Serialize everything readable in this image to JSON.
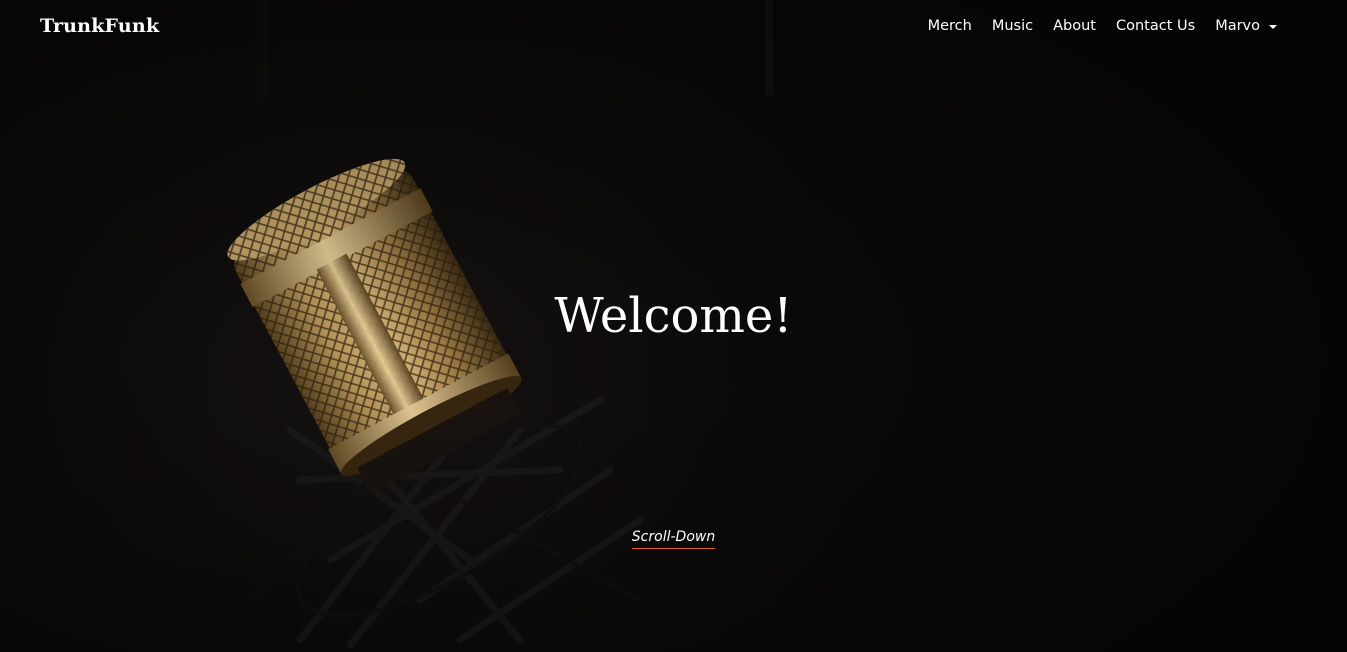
{
  "navbar": {
    "brand": "TrunkFunk",
    "links": [
      {
        "label": "Merch"
      },
      {
        "label": "Music"
      },
      {
        "label": "About"
      },
      {
        "label": "Contact Us"
      }
    ],
    "dropdown": {
      "label": "Marvo",
      "icon": "caret-down-icon"
    }
  },
  "hero": {
    "title": "Welcome!",
    "scroll_label": "Scroll-Down",
    "background_image": "gold-microphone-photo"
  },
  "colors": {
    "background": "#0d0b0b",
    "text": "#ffffff",
    "accent_underline": "#e0601a",
    "mic_gold": "#a88a52"
  }
}
